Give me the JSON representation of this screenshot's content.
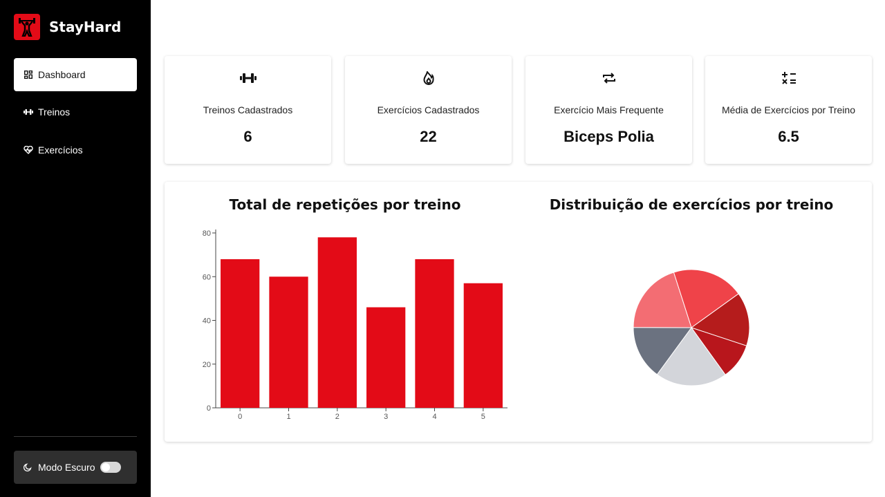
{
  "app": {
    "name": "StayHard"
  },
  "sidebar": {
    "items": [
      {
        "label": "Dashboard",
        "icon": "dashboard-grid-icon",
        "active": true
      },
      {
        "label": "Treinos",
        "icon": "dumbbell-icon",
        "active": false
      },
      {
        "label": "Exercícios",
        "icon": "heart-pulse-icon",
        "active": false
      }
    ],
    "dark_mode": {
      "label": "Modo Escuro",
      "enabled": false,
      "icon": "moon-icon"
    }
  },
  "stats": [
    {
      "icon": "dumbbell-icon",
      "label": "Treinos Cadastrados",
      "value": "6"
    },
    {
      "icon": "flame-icon",
      "label": "Exercícios Cadastrados",
      "value": "22"
    },
    {
      "icon": "repeat-icon",
      "label": "Exercício Mais Frequente",
      "value": "Biceps Polia"
    },
    {
      "icon": "calculator-icon",
      "label": "Média de Exercícios por Treino",
      "value": "6.5"
    }
  ],
  "colors": {
    "accent": "#e30b17",
    "sidebar_bg": "#000000",
    "bar": "#e30b17",
    "pie": [
      "#ef4349",
      "#b51c1c",
      "#b8161c",
      "#d3d5da",
      "#6b7280",
      "#f36d73"
    ]
  },
  "chart_data": [
    {
      "type": "bar",
      "title": "Total de repetições por treino",
      "categories": [
        "0",
        "1",
        "2",
        "3",
        "4",
        "5"
      ],
      "values": [
        68,
        60,
        78,
        46,
        68,
        57
      ],
      "yticks": [
        "0",
        "20",
        "40",
        "60",
        "80"
      ],
      "ylim": [
        0,
        80
      ],
      "xlabel": "",
      "ylabel": ""
    },
    {
      "type": "pie",
      "title": "Distribuição de exercícios por treino",
      "values": [
        4,
        3,
        2,
        4,
        3,
        4
      ]
    }
  ]
}
